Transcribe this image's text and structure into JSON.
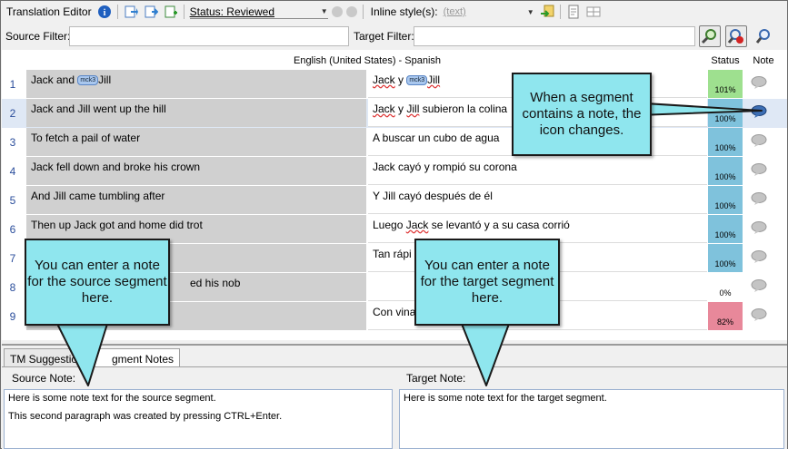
{
  "toolbar": {
    "title": "Translation Editor",
    "status_value": "Status: Reviewed",
    "inline_label": "Inline style(s):",
    "inline_value": "(text)"
  },
  "filter": {
    "source_label": "Source Filter:",
    "target_label": "Target Filter:"
  },
  "grid": {
    "language_header": "English (United States) - Spanish",
    "status_header": "Status",
    "note_header": "Note",
    "rows": [
      {
        "num": "1",
        "source_pre": "Jack and ",
        "source_tag": "mck3",
        "source_post": "Jill",
        "target_a": "Jack",
        "target_b": " y ",
        "target_tag": "mck3",
        "target_c": "Jill",
        "status": "101%",
        "status_color": "#9ee08f"
      },
      {
        "num": "2",
        "source": "Jack and Jill went up the hill",
        "target_a": "Jack",
        "target_b": " y ",
        "target_c": "Jill",
        "target_d": " subieron la colina",
        "status": "100%",
        "status_color": "#7fc2dc"
      },
      {
        "num": "3",
        "source": "To fetch a pail of water",
        "target": "A buscar un cubo de agua",
        "status": "100%",
        "status_color": "#7fc2dc"
      },
      {
        "num": "4",
        "source": "Jack fell down and broke his crown",
        "target": "Jack cayó y rompió su corona",
        "status": "100%",
        "status_color": "#7fc2dc"
      },
      {
        "num": "5",
        "source": "And Jill came tumbling after",
        "target": "Y Jill cayó después de él",
        "status": "100%",
        "status_color": "#7fc2dc"
      },
      {
        "num": "6",
        "source": "Then up Jack got and home did trot",
        "target_a": "Luego ",
        "target_b": "Jack",
        "target_c": " se levantó y a su casa corrió",
        "status": "100%",
        "status_color": "#7fc2dc"
      },
      {
        "num": "7",
        "source": "",
        "target": "Tan rápi",
        "status": "100%",
        "status_color": "#7fc2dc"
      },
      {
        "num": "8",
        "source": "ed his nob",
        "target": "",
        "status": "0%",
        "status_color": "#ffffff"
      },
      {
        "num": "9",
        "source": "",
        "target": "Con vina",
        "status": "82%",
        "status_color": "#e8889a"
      }
    ]
  },
  "tabs": {
    "tm": "TM Suggestions",
    "notes": "gment Notes"
  },
  "notes": {
    "source_label": "Source Note:",
    "target_label": "Target Note:",
    "source_p1": "Here is some note text for the source segment.",
    "source_p2": "This second paragraph was created by pressing CTRL+Enter.",
    "target_p1": "Here is some note text for the target segment."
  },
  "callouts": {
    "segment_note": "When a segment contains a note, the icon changes.",
    "source_note": "You can enter a note for the source segment here.",
    "target_note": "You can enter a note for the target segment here."
  },
  "colors": {
    "note_icon_default": "#b9b9b9",
    "note_icon_active": "#3d6fb5",
    "callout_fill": "#8fe6ee"
  }
}
